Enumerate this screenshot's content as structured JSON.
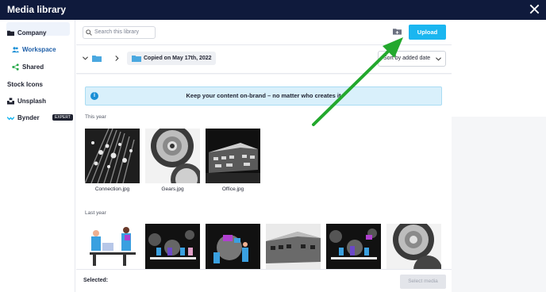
{
  "window": {
    "title": "Media library"
  },
  "sidebar": {
    "items": [
      {
        "label": "Company",
        "icon": "folder-icon"
      },
      {
        "label": "Workspace",
        "icon": "users-icon"
      },
      {
        "label": "Shared",
        "icon": "share-icon"
      },
      {
        "label": "Stock Icons"
      },
      {
        "label": "Unsplash",
        "icon": "unsplash-icon"
      },
      {
        "label": "Bynder",
        "icon": "bynder-icon",
        "badge": "EXPERT"
      }
    ]
  },
  "toolbar": {
    "search_placeholder": "Search this library",
    "upload_label": "Upload"
  },
  "breadcrumb": {
    "current_folder": "Copied on May 17th, 2022"
  },
  "sort": {
    "selected": "Sort by added date"
  },
  "banner": {
    "text": "Keep your content on-brand – no matter who creates it"
  },
  "sections": {
    "this_year": {
      "title": "This year",
      "items": [
        {
          "caption": "Connection.jpg"
        },
        {
          "caption": "Gears.jpg"
        },
        {
          "caption": "Office.jpg"
        }
      ]
    },
    "last_year": {
      "title": "Last year"
    }
  },
  "footer": {
    "selected_label": "Selected:",
    "select_button": "Select media"
  },
  "colors": {
    "titlebar": "#0f1a3c",
    "accent": "#1ab6f0",
    "annotation_arrow": "#23a82d"
  }
}
